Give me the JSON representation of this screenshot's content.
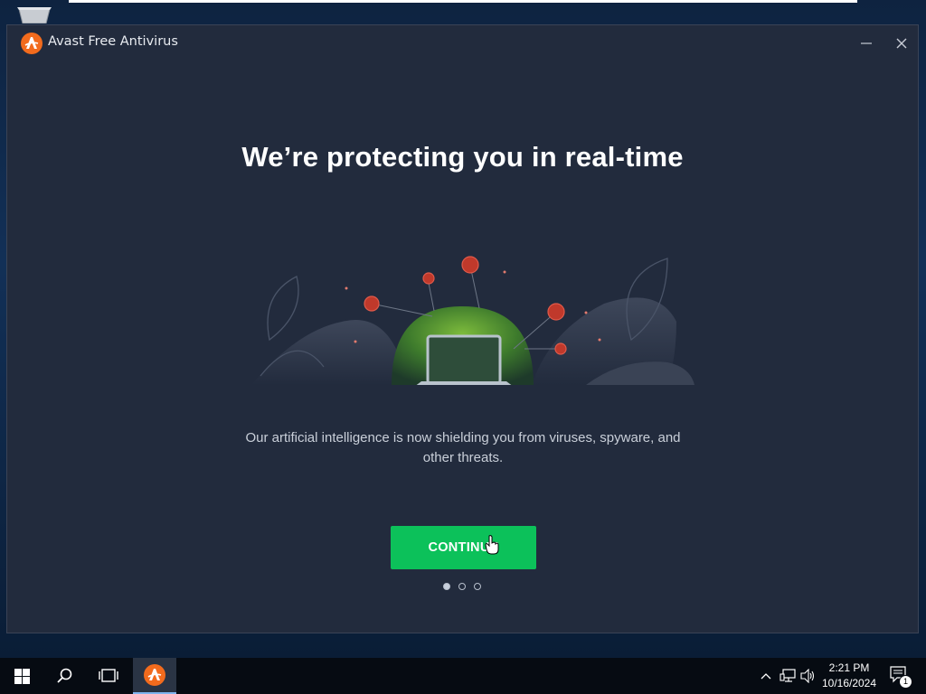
{
  "window": {
    "title": "Avast Free Antivirus"
  },
  "onboarding": {
    "headline": "We’re protecting you in real-time",
    "description": "Our artificial intelligence is now shielding you from viruses, spyware, and other threats.",
    "continue_label": "CONTINUE",
    "pager": {
      "total": 3,
      "active": 1
    }
  },
  "taskbar": {
    "time": "2:21 PM",
    "date": "10/16/2024",
    "notification_count": "1",
    "pinned": [
      "windows-icon",
      "search-icon",
      "task-view-icon",
      "avast-icon"
    ]
  },
  "colors": {
    "accent_green": "#0cc15a",
    "window_bg": "#222b3d",
    "avast_orange": "#f26b1d",
    "taskbar_bg": "#060b12"
  }
}
